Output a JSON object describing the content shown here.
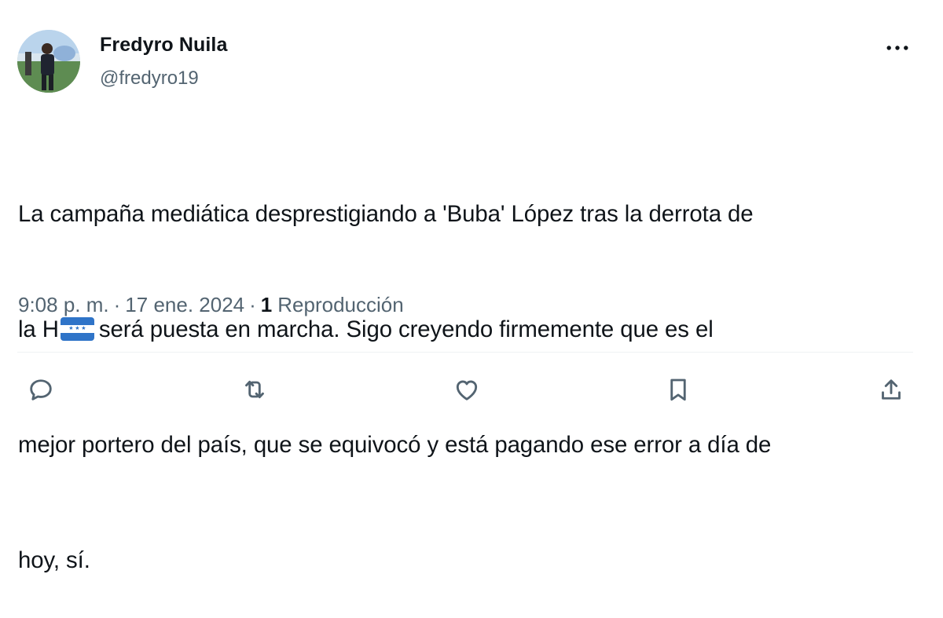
{
  "tweet": {
    "author_name": "Fredyro Nuila",
    "handle": "@fredyro19",
    "text_lines": [
      "La campaña mediática desprestigiando a 'Buba' López tras la derrota de",
      "será puesta en marcha. Sigo creyendo firmemente que es el",
      "mejor portero del país, que se equivocó y está pagando ese error a día de",
      "hoy, sí."
    ],
    "line2_prefix": "la H",
    "flag_emoji": "honduras-flag",
    "time": "9:08 p. m.",
    "date": "17 ene. 2024",
    "separator": "·",
    "views_count": "1",
    "views_label": "Reproducción"
  },
  "icons": {
    "more": "more-horizontal-icon",
    "reply": "reply-icon",
    "retweet": "retweet-icon",
    "like": "like-icon",
    "bookmark": "bookmark-icon",
    "share": "share-icon"
  },
  "colors": {
    "text": "#0f1419",
    "secondary": "#536471",
    "divider": "#eff3f4",
    "flag_blue": "#2f74c8"
  }
}
